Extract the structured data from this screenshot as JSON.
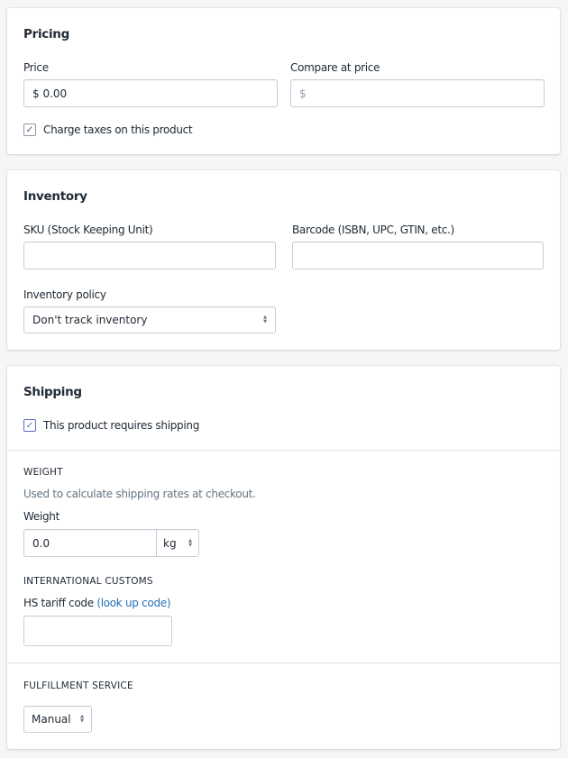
{
  "pricing": {
    "title": "Pricing",
    "price_label": "Price",
    "price_value": "$ 0.00",
    "compare_label": "Compare at price",
    "compare_placeholder": "$",
    "charge_taxes_label": "Charge taxes on this product",
    "charge_taxes_checked": true
  },
  "inventory": {
    "title": "Inventory",
    "sku_label": "SKU (Stock Keeping Unit)",
    "sku_value": "",
    "barcode_label": "Barcode (ISBN, UPC, GTIN, etc.)",
    "barcode_value": "",
    "policy_label": "Inventory policy",
    "policy_value": "Don't track inventory"
  },
  "shipping": {
    "title": "Shipping",
    "requires_shipping_label": "This product requires shipping",
    "requires_shipping_checked": true,
    "weight": {
      "heading": "WEIGHT",
      "help": "Used to calculate shipping rates at checkout.",
      "label": "Weight",
      "value": "0.0",
      "unit": "kg"
    },
    "customs": {
      "heading": "INTERNATIONAL CUSTOMS",
      "hs_label": "HS tariff code",
      "lookup_link": "(look up code)",
      "hs_value": ""
    },
    "fulfillment": {
      "heading": "FULFILLMENT SERVICE",
      "value": "Manual"
    }
  },
  "colors": {
    "accent": "#5c6ac4",
    "link": "#2470b8",
    "background": "#f4f6f8"
  },
  "icons": {
    "checkbox_check": "check-icon",
    "select_arrows": "chevron-up-down-icon"
  }
}
